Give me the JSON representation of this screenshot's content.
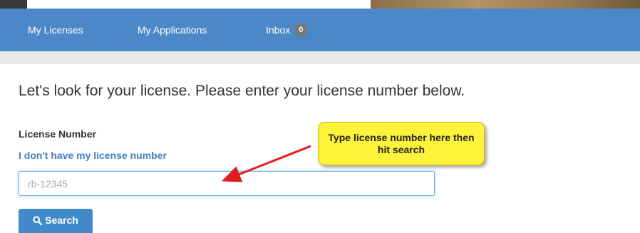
{
  "nav": {
    "items": [
      {
        "label": "My Licenses"
      },
      {
        "label": "My Applications"
      },
      {
        "label": "Inbox"
      }
    ],
    "inbox_count": "0"
  },
  "main": {
    "heading": "Let's look for your license. Please enter your license number below.",
    "field_label": "License Number",
    "help_link": "I don't have my license number",
    "input_placeholder": "rb-12345",
    "search_label": "Search"
  },
  "annotation": {
    "callout_text": "Type license number here then hit search"
  },
  "colors": {
    "navbar": "#4a88c7",
    "link": "#3f7fbf",
    "button": "#428bca",
    "callout": "#fff23a",
    "arrow": "#e21b1b"
  },
  "icons": {
    "search_button_icon": "magnifier-icon"
  }
}
